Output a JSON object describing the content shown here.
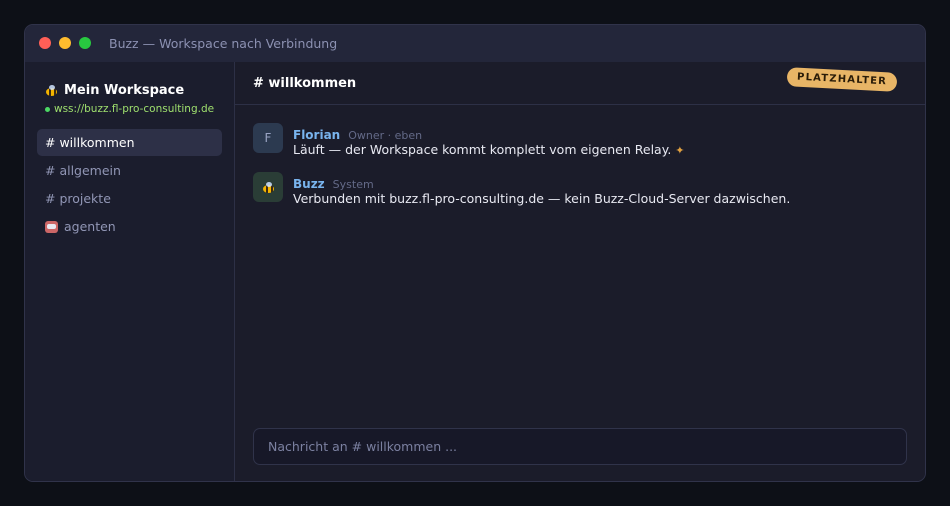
{
  "window": {
    "title": "Buzz — Workspace nach Verbindung"
  },
  "sidebar": {
    "workspace_name": "Mein Workspace",
    "workspace_url": "wss://buzz.fl-pro-consulting.de",
    "channels": [
      {
        "label": "# willkommen",
        "active": true
      },
      {
        "label": "# allgemein",
        "active": false
      },
      {
        "label": "# projekte",
        "active": false
      },
      {
        "label": "agenten",
        "active": false
      }
    ]
  },
  "header": {
    "channel_title": "# willkommen",
    "badge": "PLATZHALTER"
  },
  "messages": [
    {
      "avatar": "F",
      "author": "Florian",
      "meta": "Owner · eben",
      "text": "Läuft — der Workspace kommt komplett vom eigenen Relay."
    },
    {
      "avatar": "",
      "author": "Buzz",
      "meta": "System",
      "text": "Verbunden mit buzz.fl-pro-consulting.de — kein Buzz-Cloud-Server dazwischen."
    }
  ],
  "composer": {
    "placeholder": "Nachricht an # willkommen ..."
  },
  "colors": {
    "accent": "#79b4ee",
    "badge": "#e8b566",
    "url": "#9fe06e",
    "background": "#1b1c2a"
  },
  "icons": [
    "bee-icon",
    "robot-icon",
    "party-popper-icon"
  ]
}
